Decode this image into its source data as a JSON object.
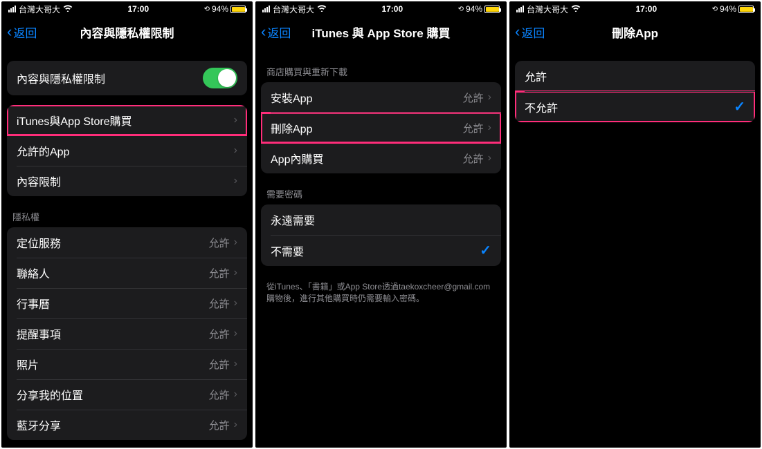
{
  "status": {
    "carrier": "台灣大哥大",
    "time": "17:00",
    "battery_pct": "94%"
  },
  "screen1": {
    "back": "返回",
    "title": "內容與隱私權限制",
    "toggle_label": "內容與隱私權限制",
    "rows1": [
      {
        "label": "iTunes與App Store購買",
        "hl": true
      },
      {
        "label": "允許的App"
      },
      {
        "label": "內容限制"
      }
    ],
    "privacy_header": "隱私權",
    "rows2": [
      {
        "label": "定位服務",
        "value": "允許"
      },
      {
        "label": "聯絡人",
        "value": "允許"
      },
      {
        "label": "行事曆",
        "value": "允許"
      },
      {
        "label": "提醒事項",
        "value": "允許"
      },
      {
        "label": "照片",
        "value": "允許"
      },
      {
        "label": "分享我的位置",
        "value": "允許"
      },
      {
        "label": "藍牙分享",
        "value": "允許"
      }
    ]
  },
  "screen2": {
    "back": "返回",
    "title": "iTunes 與 App Store 購買",
    "header1": "商店購買與重新下載",
    "rows1": [
      {
        "label": "安裝App",
        "value": "允許"
      },
      {
        "label": "刪除App",
        "value": "允許",
        "hl": true
      },
      {
        "label": "App內購買",
        "value": "允許"
      }
    ],
    "header2": "需要密碼",
    "rows2": [
      {
        "label": "永遠需要"
      },
      {
        "label": "不需要",
        "checked": true
      }
    ],
    "footer": "從iTunes、「書籍」或App Store透過taekoxcheer@gmail.com購物後，進行其他購買時仍需要輸入密碼。"
  },
  "screen3": {
    "back": "返回",
    "title": "刪除App",
    "rows": [
      {
        "label": "允許"
      },
      {
        "label": "不允許",
        "checked": true,
        "hl": true
      }
    ]
  }
}
